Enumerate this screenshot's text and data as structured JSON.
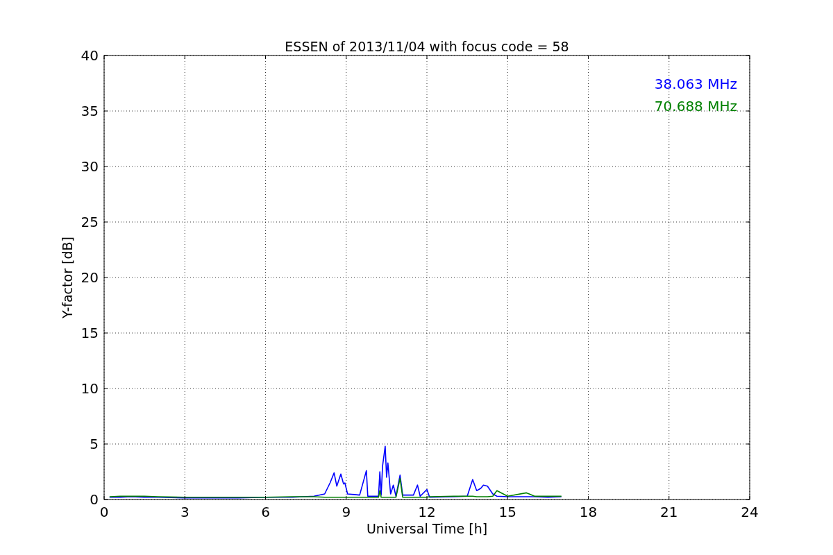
{
  "chart_data": {
    "type": "line",
    "title": "ESSEN of 2013/11/04 with focus code = 58",
    "xlabel": "Universal Time [h]",
    "ylabel": "Y-factor [dB]",
    "x": [
      0.2,
      0.6,
      1.0,
      1.5,
      2.0,
      3.0,
      4.0,
      5.0,
      6.0,
      7.0,
      7.8,
      8.2,
      8.4,
      8.55,
      8.65,
      8.8,
      8.9,
      8.95,
      9.05,
      9.5,
      9.75,
      9.8,
      10.2,
      10.25,
      10.3,
      10.35,
      10.45,
      10.5,
      10.55,
      10.65,
      10.75,
      10.85,
      11.0,
      11.1,
      11.5,
      11.65,
      11.75,
      12.0,
      12.1,
      13.0,
      13.5,
      13.7,
      13.85,
      14.0,
      14.1,
      14.25,
      14.45,
      14.6,
      15.0,
      15.7,
      16.0,
      16.5,
      17.0
    ],
    "series": [
      {
        "name": "38.063 MHz",
        "color": "#0000ff",
        "values": [
          0.2,
          0.2,
          0.25,
          0.2,
          0.2,
          0.15,
          0.15,
          0.15,
          0.2,
          0.2,
          0.3,
          0.5,
          1.5,
          2.4,
          1.2,
          2.3,
          1.4,
          1.5,
          0.5,
          0.4,
          2.6,
          0.3,
          0.3,
          2.5,
          0.4,
          3.0,
          4.8,
          2.0,
          3.3,
          0.5,
          1.3,
          0.3,
          2.2,
          0.4,
          0.4,
          1.3,
          0.3,
          0.9,
          0.2,
          0.25,
          0.3,
          1.8,
          0.8,
          1.0,
          1.3,
          1.2,
          0.5,
          0.3,
          0.25,
          0.25,
          0.25,
          0.2,
          0.25
        ]
      },
      {
        "name": "70.688 MHz",
        "color": "#008000",
        "values": [
          0.25,
          0.3,
          0.3,
          0.3,
          0.25,
          0.2,
          0.2,
          0.2,
          0.2,
          0.25,
          0.25,
          0.2,
          0.2,
          0.2,
          0.2,
          0.2,
          0.2,
          0.2,
          0.2,
          0.2,
          0.2,
          0.2,
          0.2,
          0.8,
          0.2,
          0.2,
          0.2,
          0.2,
          0.2,
          0.2,
          0.2,
          0.2,
          1.9,
          0.2,
          0.2,
          0.2,
          0.2,
          0.2,
          0.25,
          0.3,
          0.3,
          0.3,
          0.25,
          0.25,
          0.25,
          0.25,
          0.3,
          0.8,
          0.3,
          0.6,
          0.3,
          0.3,
          0.3
        ]
      }
    ],
    "xlim": [
      0,
      24
    ],
    "ylim": [
      0,
      40
    ],
    "xticks": [
      0,
      3,
      6,
      9,
      12,
      15,
      18,
      21,
      24
    ],
    "yticks": [
      0,
      5,
      10,
      15,
      20,
      25,
      30,
      35,
      40
    ],
    "grid": true
  }
}
